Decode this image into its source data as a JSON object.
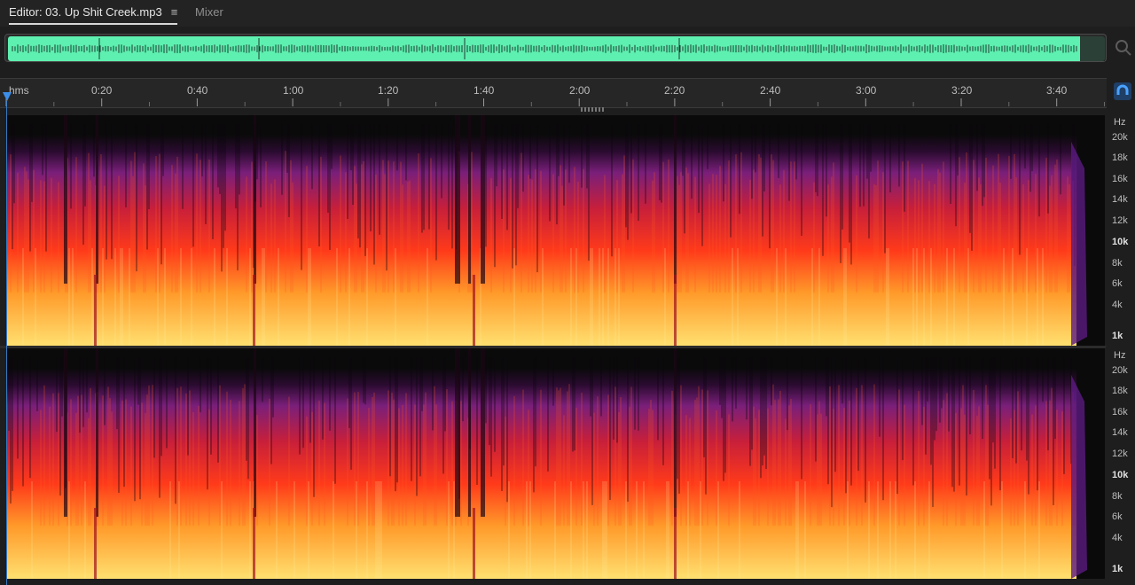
{
  "tabs": {
    "editor_label": "Editor: 03. Up Shit Creek.mp3",
    "menu_glyph": "≡",
    "mixer_label": "Mixer"
  },
  "ruler": {
    "unit_label": "hms",
    "marks": [
      "0:20",
      "0:40",
      "1:00",
      "1:20",
      "1:40",
      "2:00",
      "2:20",
      "2:40",
      "3:00",
      "3:20",
      "3:40"
    ]
  },
  "hz_scale": {
    "unit": "Hz",
    "labels": [
      "20k",
      "18k",
      "16k",
      "14k",
      "12k",
      "10k",
      "8k",
      "6k",
      "4k",
      "1k"
    ]
  },
  "icons": {
    "zoom": "zoom-magnifier-icon",
    "snap": "snap-magnet-icon",
    "playhead": "playhead-marker-icon"
  },
  "colors": {
    "waveform": "#5ef0b0",
    "playhead": "#3b8eea",
    "spectro_low": "#ffe070",
    "spectro_mid": "#ff3a1a",
    "spectro_high": "#7a1f7a"
  }
}
